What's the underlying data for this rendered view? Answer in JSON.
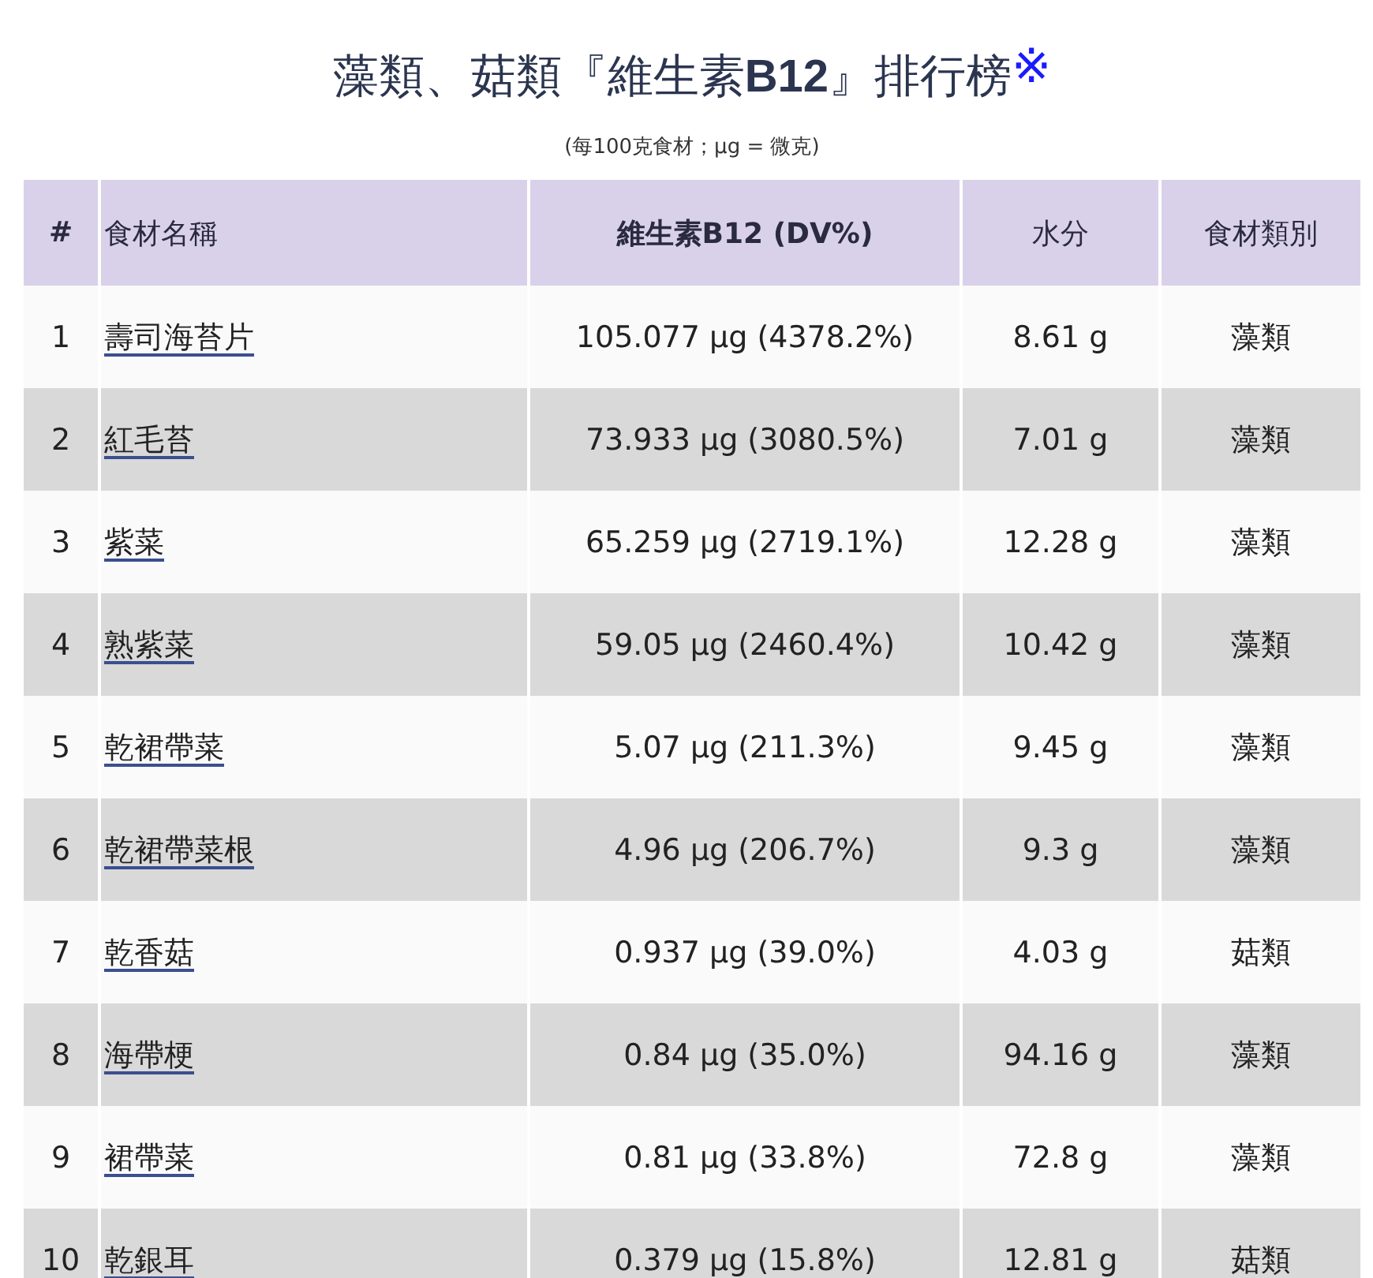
{
  "title": "藻類、菇類『維生素**B12**』排行榜",
  "note_mark": "※",
  "subtitle": "(每100克食材；μg = 微克)",
  "table": {
    "columns": [
      "#",
      "食材名稱",
      "維生素B12 (DV%)",
      "水分",
      "食材類別"
    ],
    "rows": [
      {
        "rank": "1",
        "name": "壽司海苔片",
        "b12": "105.077 μg (4378.2%)",
        "water": "8.61 g",
        "category": "藻類"
      },
      {
        "rank": "2",
        "name": "紅毛苔",
        "b12": "73.933 μg (3080.5%)",
        "water": "7.01 g",
        "category": "藻類"
      },
      {
        "rank": "3",
        "name": "紫菜",
        "b12": "65.259 μg (2719.1%)",
        "water": "12.28 g",
        "category": "藻類"
      },
      {
        "rank": "4",
        "name": "熟紫菜",
        "b12": "59.05 μg (2460.4%)",
        "water": "10.42 g",
        "category": "藻類"
      },
      {
        "rank": "5",
        "name": "乾裙帶菜",
        "b12": "5.07 μg (211.3%)",
        "water": "9.45 g",
        "category": "藻類"
      },
      {
        "rank": "6",
        "name": "乾裙帶菜根",
        "b12": "4.96 μg (206.7%)",
        "water": "9.3 g",
        "category": "藻類"
      },
      {
        "rank": "7",
        "name": "乾香菇",
        "b12": "0.937 μg (39.0%)",
        "water": "4.03 g",
        "category": "菇類"
      },
      {
        "rank": "8",
        "name": "海帶梗",
        "b12": "0.84 μg (35.0%)",
        "water": "94.16 g",
        "category": "藻類"
      },
      {
        "rank": "9",
        "name": "裙帶菜",
        "b12": "0.81 μg (33.8%)",
        "water": "72.8 g",
        "category": "藻類"
      },
      {
        "rank": "10",
        "name": "乾銀耳",
        "b12": "0.379 μg (15.8%)",
        "water": "12.81 g",
        "category": "菇類"
      }
    ]
  }
}
